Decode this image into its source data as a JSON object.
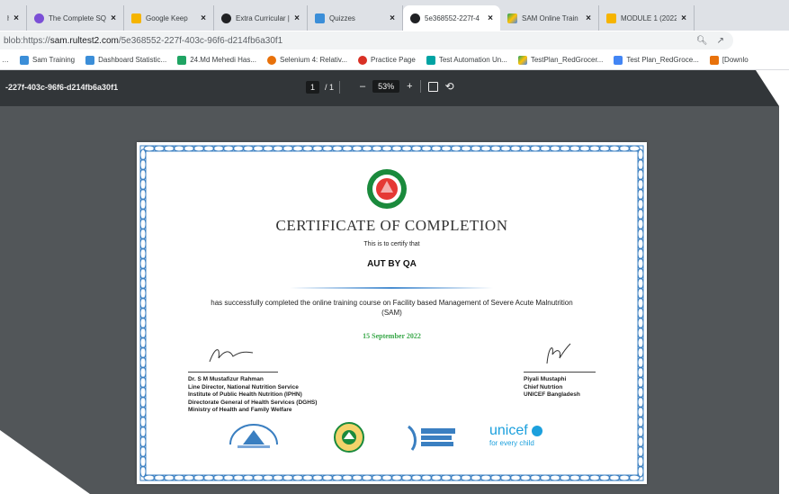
{
  "tabs": [
    {
      "label": "h",
      "color": "#bbbbbb"
    },
    {
      "label": "The Complete SQ",
      "color": "#7b4fd6"
    },
    {
      "label": "Google Keep",
      "color": "#f5b400"
    },
    {
      "label": "Extra Curricular |",
      "color": "#202124"
    },
    {
      "label": "Quizzes",
      "color": "#3b8ed8"
    },
    {
      "label": "5e368552-227f-4",
      "color": "#202124",
      "active": true
    },
    {
      "label": "SAM Online Train",
      "color": "#1fa463"
    },
    {
      "label": "MODULE 1 (2022",
      "color": "#f6b400"
    }
  ],
  "address": {
    "prefix": "blob:https://",
    "host": "sam.rultest2.com",
    "path": "/5e368552-227f-403c-96f6-d214fb6a30f1"
  },
  "bookmarks": [
    {
      "label": "Sam Training",
      "color": "#3b8ed8"
    },
    {
      "label": "Dashboard Statistic...",
      "color": "#3b8ed8"
    },
    {
      "label": "24.Md Mehedi Has...",
      "color": "#1fa463"
    },
    {
      "label": "Selenium 4: Relativ...",
      "color": "#e8710a"
    },
    {
      "label": "Practice Page",
      "color": "#d93025"
    },
    {
      "label": "Test Automation Un...",
      "color": "#00a3a3"
    },
    {
      "label": "TestPlan_RedGrocer...",
      "color": "#1fa463"
    },
    {
      "label": "Test Plan_RedGroce...",
      "color": "#4285f4"
    },
    {
      "label": "[Downlo",
      "color": "#e8710a"
    }
  ],
  "toolbar": {
    "doc_title": "-227f-403c-96f6-d214fb6a30f1",
    "page_current": "1",
    "page_sep": "/ 1",
    "zoom": "53%",
    "minus": "–",
    "plus": "+"
  },
  "certificate": {
    "title": "CERTIFICATE OF COMPLETION",
    "certify": "This is to certify that",
    "name": "AUT BY QA",
    "description": "has successfully completed the online training course on Facility based Management of Severe Acute Malnutrition (SAM)",
    "date": "15 September 2022",
    "left_signatory": {
      "name": "Dr. S M Mustafizur Rahman",
      "line1": "Line Director, National Nutrition Service",
      "line2": "Institute of Public Health Nutrition (IPHN)",
      "line3": "Directorate General of Health Services (DGHS)",
      "line4": "Ministry of Health and Family Welfare"
    },
    "right_signatory": {
      "name": "Piyali Mustaphi",
      "line1": "Chief Nutrtion",
      "line2": "UNICEF Bangladesh"
    },
    "unicef": {
      "word": "unicef",
      "tagline": "for every child"
    }
  },
  "colors": {
    "toolbar": "#323639",
    "canvas": "#525659",
    "border_blue": "#3a7fc1",
    "date_green": "#3aa84a"
  }
}
